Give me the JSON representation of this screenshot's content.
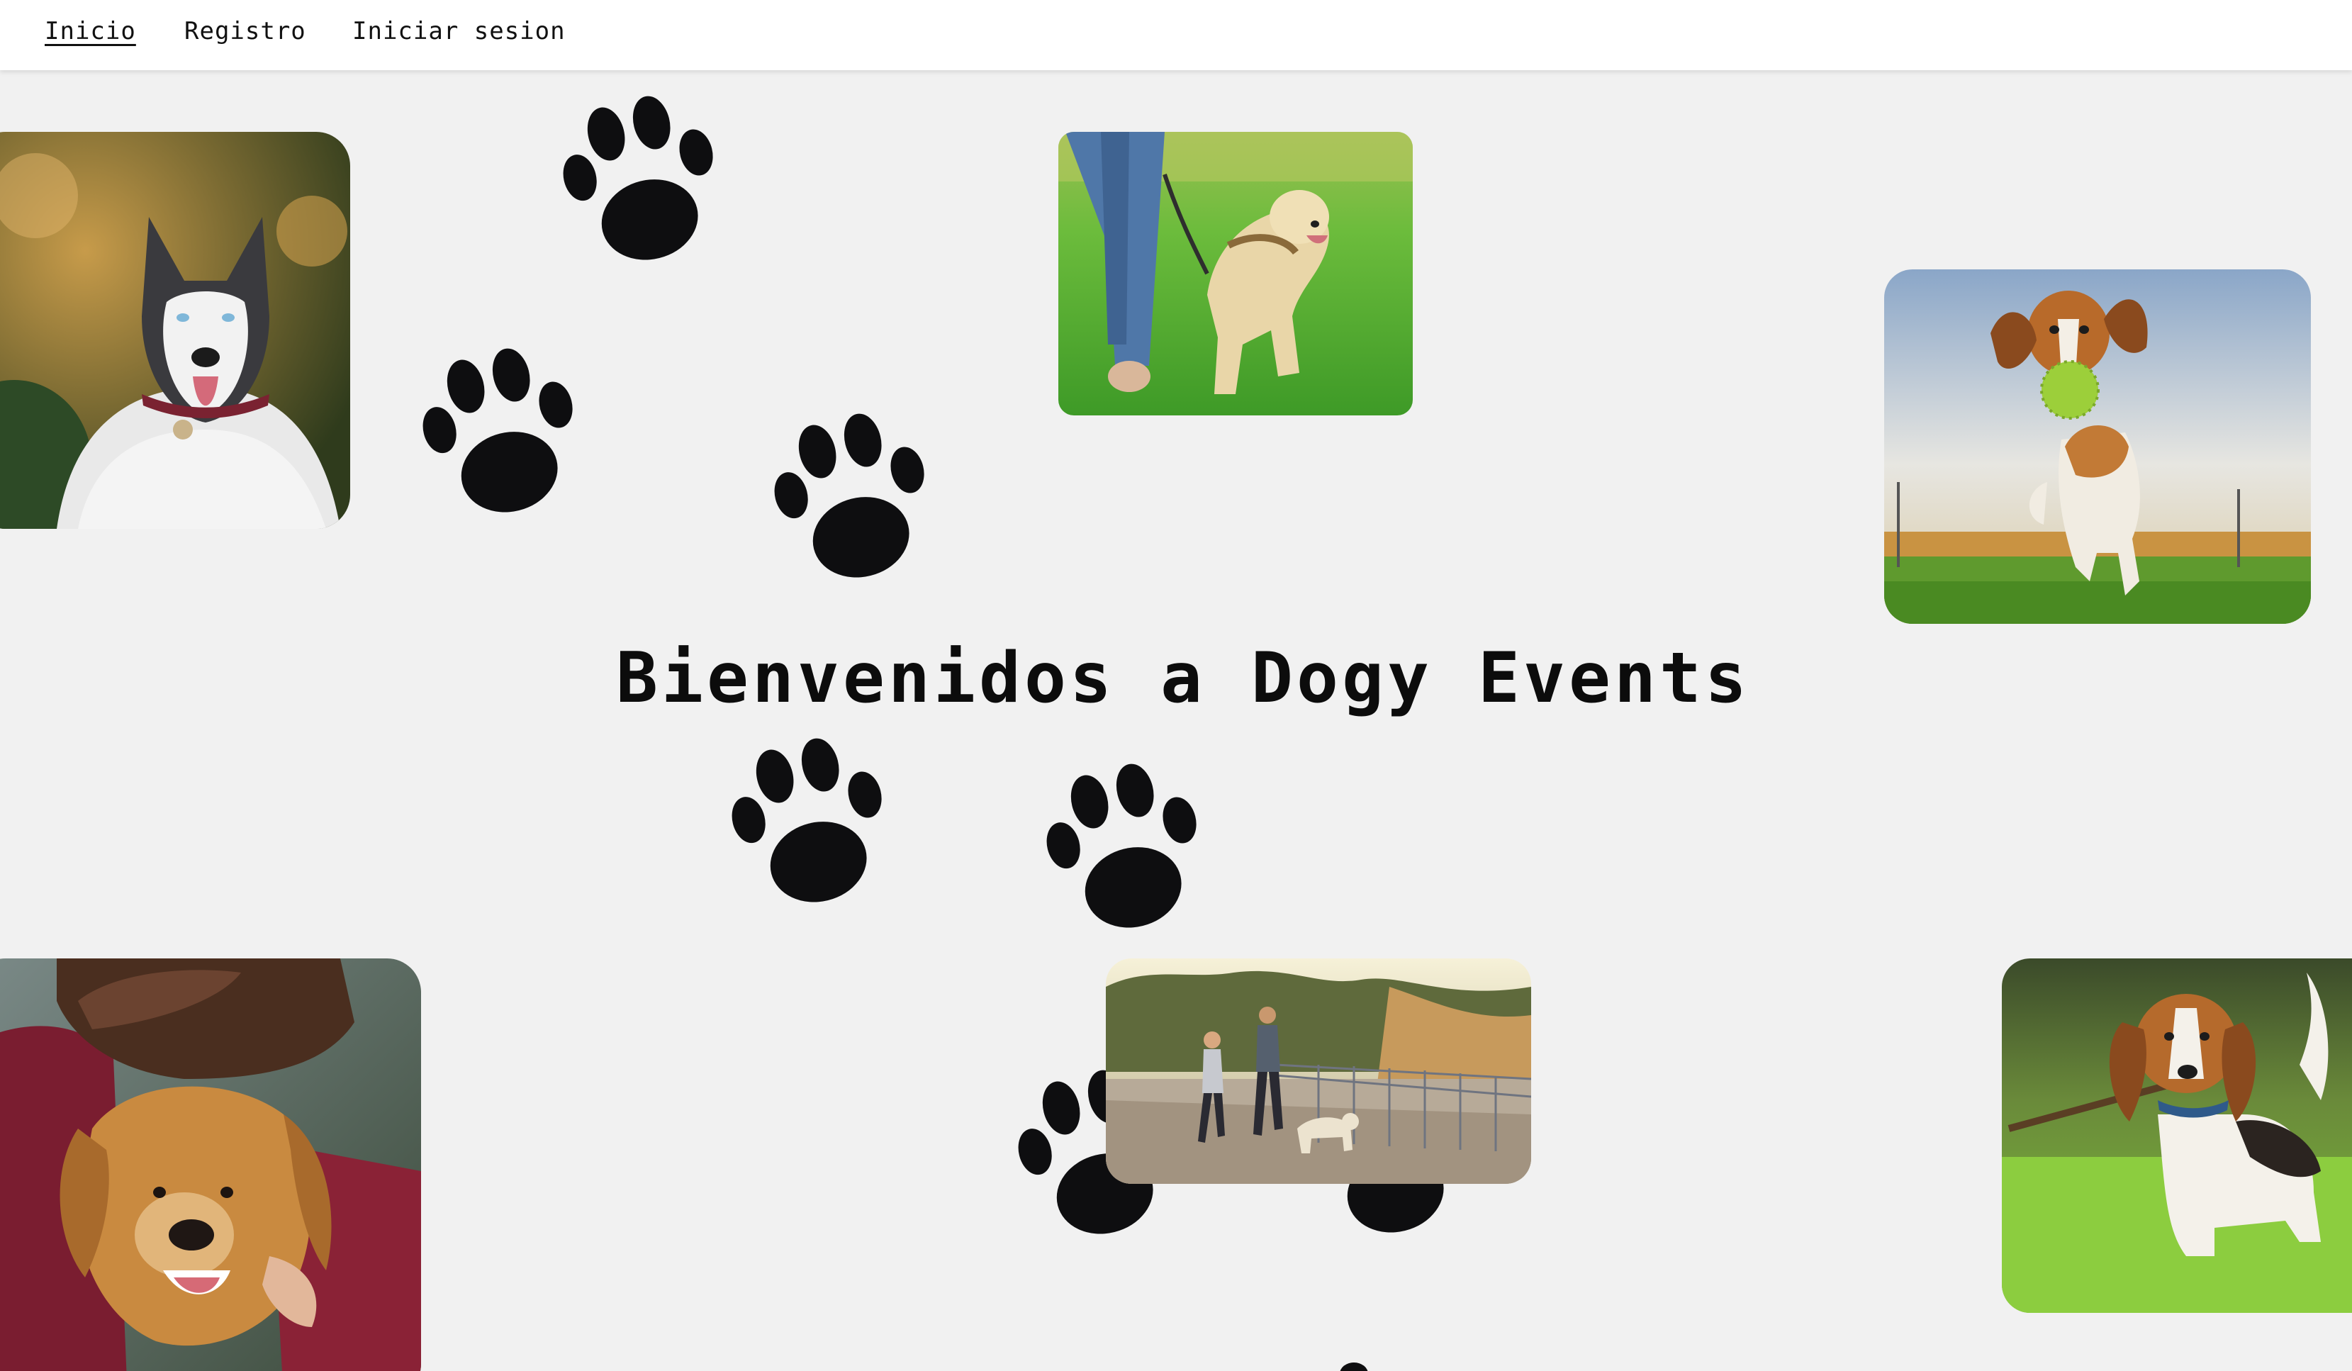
{
  "nav": {
    "items": [
      {
        "label": "Inicio",
        "active": true
      },
      {
        "label": "Registro",
        "active": false
      },
      {
        "label": "Iniciar sesion",
        "active": false
      }
    ]
  },
  "hero": {
    "title": "Bienvenidos a Dogy Events"
  },
  "theme": {
    "background": "#f1f1f1",
    "navbar_bg": "#ffffff",
    "text": "#0c0c0c",
    "paw_color": "#0e0e10"
  },
  "icons": {
    "paw": "paw-print-icon"
  }
}
